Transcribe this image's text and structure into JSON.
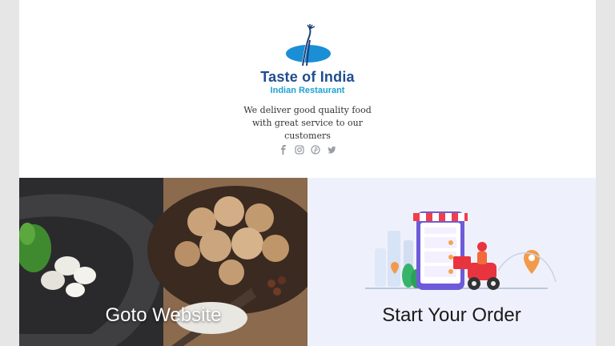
{
  "brand": {
    "name": "Taste of India",
    "subtitle": "Indian Restaurant",
    "tagline": "We deliver good quality food with great service to our customers",
    "title_color": "#1f4d8f",
    "subtitle_color": "#1aa3d6"
  },
  "social": [
    {
      "icon": "facebook-icon"
    },
    {
      "icon": "instagram-icon"
    },
    {
      "icon": "pinterest-icon"
    },
    {
      "icon": "twitter-icon"
    }
  ],
  "panels": {
    "website_label": "Goto Website",
    "order_label": "Start Your Order"
  }
}
